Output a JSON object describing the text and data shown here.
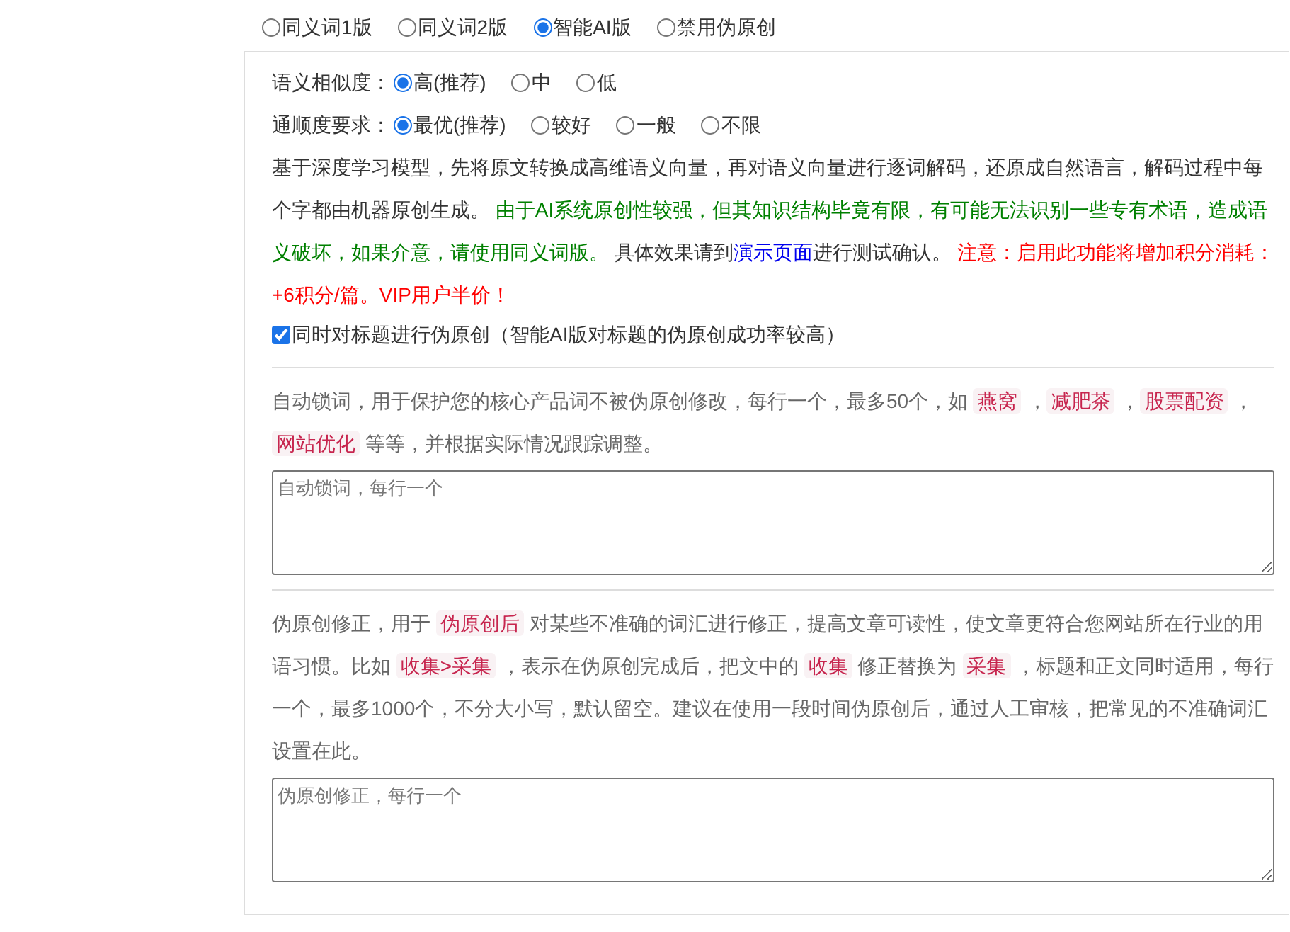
{
  "modes": [
    {
      "label": "同义词1版",
      "selected": false
    },
    {
      "label": "同义词2版",
      "selected": false
    },
    {
      "label": "智能AI版",
      "selected": true
    },
    {
      "label": "禁用伪原创",
      "selected": false
    }
  ],
  "settings": [
    {
      "label": "语义相似度：",
      "options": [
        {
          "label": "高(推荐)",
          "selected": true
        },
        {
          "label": "中",
          "selected": false
        },
        {
          "label": "低",
          "selected": false
        }
      ]
    },
    {
      "label": "通顺度要求：",
      "options": [
        {
          "label": "最优(推荐)",
          "selected": true
        },
        {
          "label": "较好",
          "selected": false
        },
        {
          "label": "一般",
          "selected": false
        },
        {
          "label": "不限",
          "selected": false
        }
      ]
    }
  ],
  "ai_note": [
    {
      "kind": "plain",
      "text": "基于深度学习模型，先将原文转换成高维语义向量，再对语义向量进行逐词解码，还原成自然语言，解码过程中每个字都由机器原创生成。 "
    },
    {
      "kind": "success",
      "text": "由于AI系统原创性较强，但其知识结构毕竟有限，有可能无法识别一些专有术语，造成语义破坏，如果介意，请使用同义词版。"
    },
    {
      "kind": "plain",
      "text": " 具体效果请到"
    },
    {
      "kind": "link",
      "text": "演示页面"
    },
    {
      "kind": "plain",
      "text": "进行测试确认。 "
    },
    {
      "kind": "warning",
      "text": "注意：启用此功能将增加积分消耗：+6积分/篇。VIP用户半价！"
    }
  ],
  "title_option": {
    "label": "同时对标题进行伪原创（智能AI版对标题的伪原创成功率较高）",
    "checked": true
  },
  "sections": [
    {
      "description": [
        {
          "kind": "text",
          "text": "自动锁词，用于保护您的核心产品词不被伪原创修改，每行一个，最多50个，如 "
        },
        {
          "kind": "code",
          "text": "燕窝"
        },
        {
          "kind": "text",
          "text": " ，"
        },
        {
          "kind": "code",
          "text": "减肥茶"
        },
        {
          "kind": "text",
          "text": " ，"
        },
        {
          "kind": "code",
          "text": "股票配资"
        },
        {
          "kind": "text",
          "text": " ，"
        },
        {
          "kind": "code",
          "text": "网站优化"
        },
        {
          "kind": "text",
          "text": " 等等，并根据实际情况跟踪调整。"
        }
      ],
      "placeholder": "自动锁词，每行一个"
    },
    {
      "description": [
        {
          "kind": "text",
          "text": "伪原创修正，用于 "
        },
        {
          "kind": "code",
          "text": "伪原创后"
        },
        {
          "kind": "text",
          "text": " 对某些不准确的词汇进行修正，提高文章可读性，使文章更符合您网站所在行业的用语习惯。比如 "
        },
        {
          "kind": "code",
          "text": "收集>采集"
        },
        {
          "kind": "text",
          "text": " ，表示在伪原创完成后，把文中的 "
        },
        {
          "kind": "code",
          "text": "收集"
        },
        {
          "kind": "text",
          "text": " 修正替换为 "
        },
        {
          "kind": "code",
          "text": "采集"
        },
        {
          "kind": "text",
          "text": " ，标题和正文同时适用，每行一个，最多1000个，不分大小写，默认留空。建议在使用一段时间伪原创后，通过人工审核，把常见的不准确词汇设置在此。"
        }
      ],
      "placeholder": "伪原创修正，每行一个"
    }
  ]
}
